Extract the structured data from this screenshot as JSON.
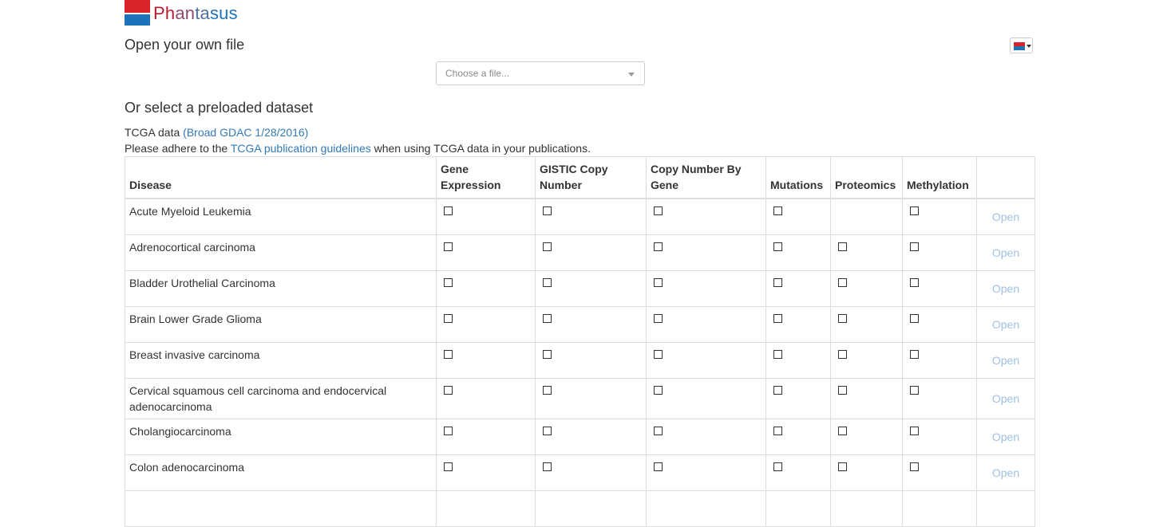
{
  "app": {
    "logo_parts": [
      "Ph",
      "an",
      "ta",
      "sus"
    ],
    "logo_icon": "phantasus-logo-icon",
    "colors": {
      "brand_red": "#d9242b",
      "brand_blue": "#1c73b9",
      "link": "#337ab7",
      "open_link": "#9fc2e0"
    }
  },
  "open_file": {
    "heading": "Open your own file",
    "select_placeholder": "Choose a file...",
    "language_button_icon": "flag-icon"
  },
  "preloaded": {
    "heading": "Or select a preloaded dataset",
    "tcga_label": "TCGA data",
    "tcga_source_link": "(Broad GDAC 1/28/2016)",
    "adhere_prefix": "Please adhere to the ",
    "guidelines_link": "TCGA publication guidelines",
    "adhere_suffix": " when using TCGA data in your publications."
  },
  "table": {
    "columns": [
      "Disease",
      "Gene Expression",
      "GISTIC Copy Number",
      "Copy Number By Gene",
      "Mutations",
      "Proteomics",
      "Methylation",
      ""
    ],
    "open_label": "Open",
    "rows": [
      {
        "disease": "Acute Myeloid Leukemia",
        "has": [
          true,
          true,
          true,
          true,
          false,
          true
        ]
      },
      {
        "disease": "Adrenocortical carcinoma",
        "has": [
          true,
          true,
          true,
          true,
          true,
          true
        ]
      },
      {
        "disease": "Bladder Urothelial Carcinoma",
        "has": [
          true,
          true,
          true,
          true,
          true,
          true
        ]
      },
      {
        "disease": "Brain Lower Grade Glioma",
        "has": [
          true,
          true,
          true,
          true,
          true,
          true
        ]
      },
      {
        "disease": "Breast invasive carcinoma",
        "has": [
          true,
          true,
          true,
          true,
          true,
          true
        ]
      },
      {
        "disease": "Cervical squamous cell carcinoma and endocervical adenocarcinoma",
        "has": [
          true,
          true,
          true,
          true,
          true,
          true
        ]
      },
      {
        "disease": "Cholangiocarcinoma",
        "has": [
          true,
          true,
          true,
          true,
          true,
          true
        ]
      },
      {
        "disease": "Colon adenocarcinoma",
        "has": [
          true,
          true,
          true,
          true,
          true,
          true
        ]
      },
      {
        "disease": "",
        "has": [
          false,
          false,
          false,
          false,
          false,
          false
        ]
      }
    ]
  }
}
